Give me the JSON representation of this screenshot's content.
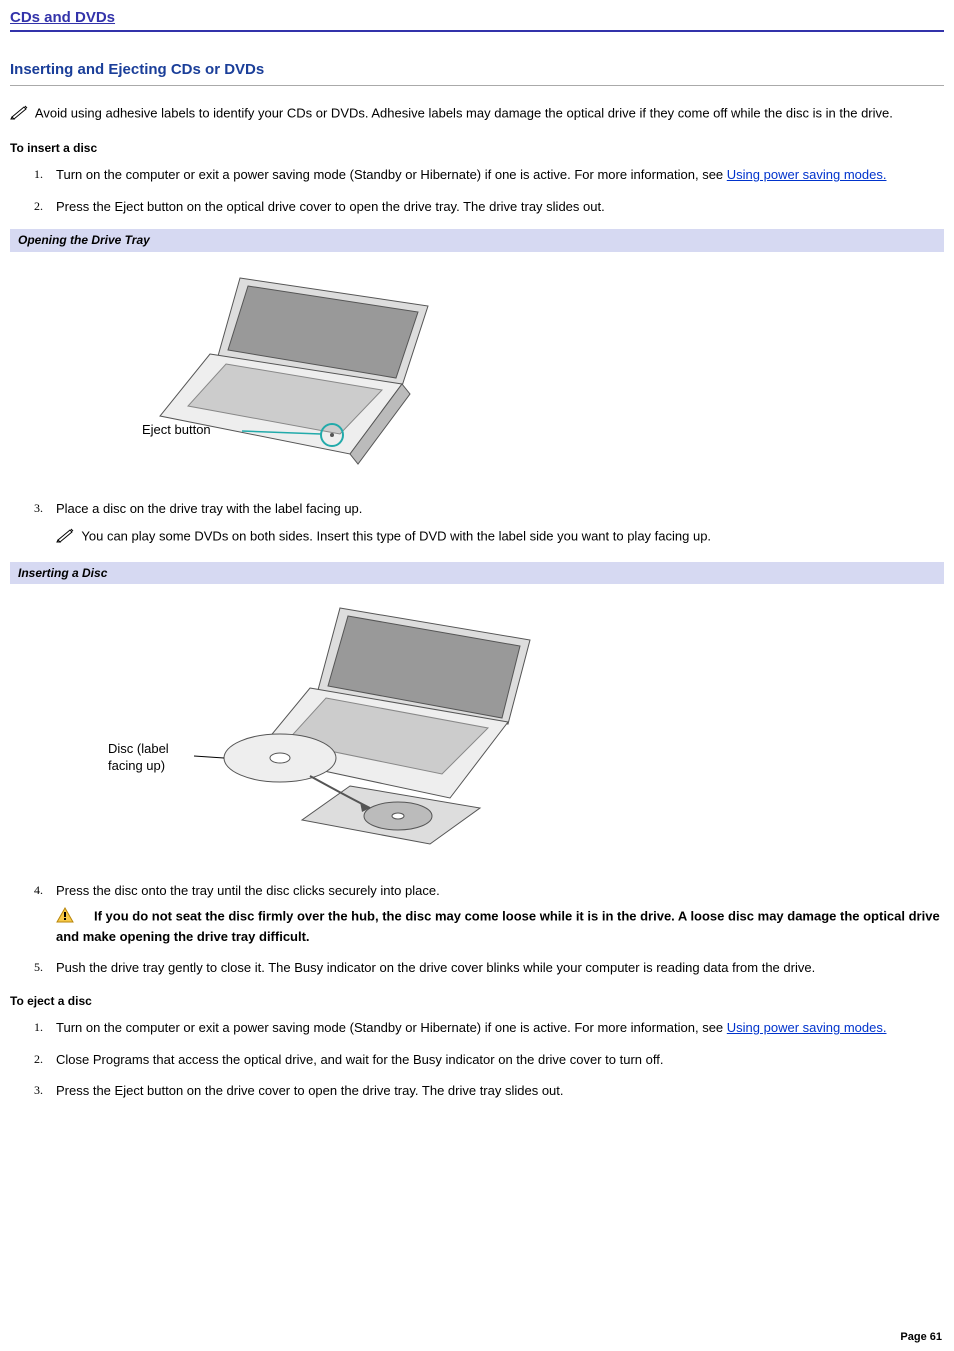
{
  "top_title": "CDs and DVDs",
  "section_title": "Inserting and Ejecting CDs or DVDs",
  "intro_note": "Avoid using adhesive labels to identify your CDs or DVDs. Adhesive labels may damage the optical drive if they come off while the disc is in the drive.",
  "insert": {
    "heading": "To insert a disc",
    "step1_a": "Turn on the computer or exit a power saving mode (Standby or Hibernate) if one is active. For more information, see ",
    "step1_link": "Using power saving modes.",
    "step2": "Press the Eject button on the optical drive cover to open the drive tray. The drive tray slides out.",
    "step3": "Place a disc on the drive tray with the label facing up.",
    "step3_note": "You can play some DVDs on both sides. Insert this type of DVD with the label side you want to play facing up.",
    "step4": "Press the disc onto the tray until the disc clicks securely into place.",
    "step4_warn": "If you do not seat the disc firmly over the hub, the disc may come loose while it is in the drive. A loose disc may damage the optical drive and make opening the drive tray difficult.",
    "step5": "Push the drive tray gently to close it. The Busy indicator on the drive cover blinks while your computer is reading data from the drive."
  },
  "fig1": {
    "caption": "Opening the Drive Tray",
    "callout": "Eject button"
  },
  "fig2": {
    "caption": "Inserting a Disc",
    "callout1": "Disc (label",
    "callout2": "facing up)"
  },
  "eject": {
    "heading": "To eject a disc",
    "step1_a": "Turn on the computer or exit a power saving mode (Standby or Hibernate) if one is active. For more information, see ",
    "step1_link": "Using power saving modes.",
    "step2": "Close Programs that access the optical drive, and wait for the Busy indicator on the drive cover to turn off.",
    "step3": "Press the Eject button on the drive cover to open the drive tray. The drive tray slides out."
  },
  "page": "Page 61"
}
